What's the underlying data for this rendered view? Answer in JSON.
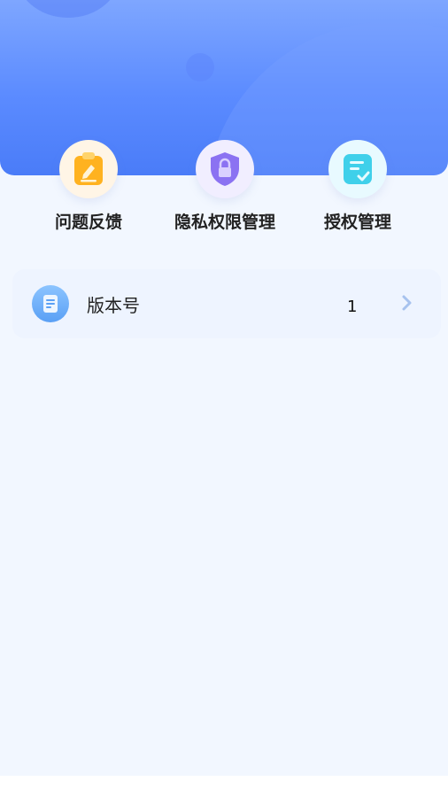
{
  "quick_actions": [
    {
      "label": "问题反馈",
      "icon": "clipboard-edit-icon"
    },
    {
      "label": "隐私权限管理",
      "icon": "shield-lock-icon"
    },
    {
      "label": "授权管理",
      "icon": "checklist-icon"
    }
  ],
  "settings_list": [
    {
      "title": "版本号",
      "value": "1",
      "icon": "document-icon"
    }
  ],
  "colors": {
    "header_top": "#7ea6ff",
    "header_bottom": "#4a7cf8",
    "page_bg": "#f2f7ff",
    "card_bg": "#eef4ff",
    "chevron": "#a7c2ee"
  }
}
